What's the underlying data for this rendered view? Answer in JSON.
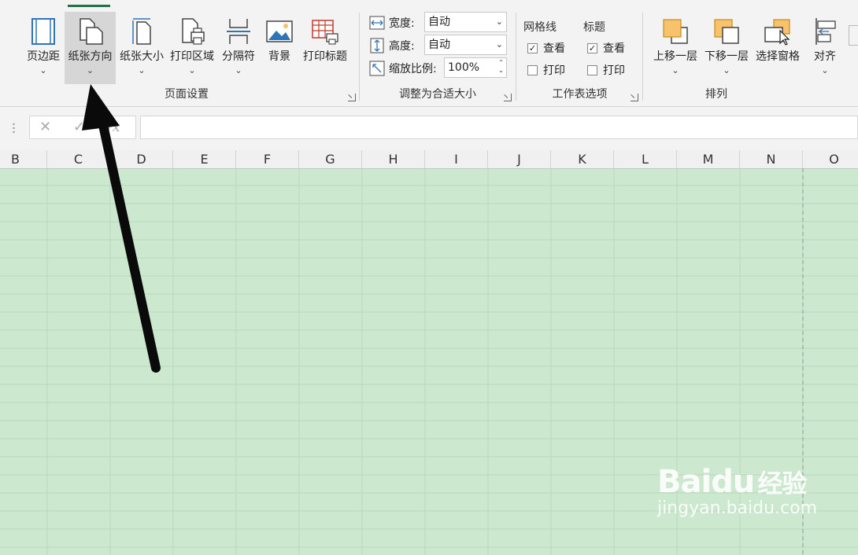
{
  "ribbon": {
    "page_setup": {
      "label": "页面设置",
      "buttons": {
        "margins": "页边距",
        "orientation": "纸张方向",
        "size": "纸张大小",
        "print_area": "打印区域",
        "breaks": "分隔符",
        "background": "背景",
        "print_titles": "打印标题"
      }
    },
    "scale_to_fit": {
      "label": "调整为合适大小",
      "width_label": "宽度:",
      "width_value": "自动",
      "height_label": "高度:",
      "height_value": "自动",
      "scale_label": "缩放比例:",
      "scale_value": "100%"
    },
    "sheet_options": {
      "label": "工作表选项",
      "gridlines": "网格线",
      "headings": "标题",
      "gridlines_view": "查看",
      "gridlines_print": "打印",
      "headings_view": "查看",
      "headings_print": "打印"
    },
    "arrange": {
      "label": "排列",
      "bring_forward": "上移一层",
      "send_backward": "下移一层",
      "selection_pane": "选择窗格",
      "align": "对齐"
    }
  },
  "formula_bar": {
    "fx": "fx",
    "cancel": "✕",
    "enter": "✓"
  },
  "columns": [
    "B",
    "C",
    "D",
    "E",
    "F",
    "G",
    "H",
    "I",
    "J",
    "K",
    "L",
    "M",
    "N",
    "O"
  ],
  "watermark": {
    "brand": "Bai",
    "brand2": "du",
    "suffix": "经验",
    "url": "jingyan.baidu.com"
  },
  "colors": {
    "sheet_bg": "#cce8cf",
    "accent": "#217346",
    "icon_blue": "#2e75b6",
    "icon_orange": "#f6c26b"
  }
}
